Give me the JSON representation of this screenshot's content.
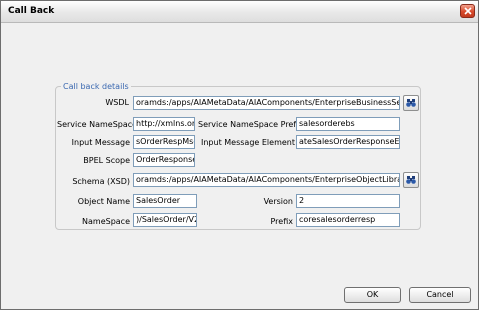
{
  "window": {
    "title": "Call Back"
  },
  "group": {
    "legend": "Call back details"
  },
  "fields": {
    "wsdl": {
      "label": "WSDL",
      "value": "oramds:/apps/AIAMetaData/AIAComponents/EnterpriseBusinessServiceLi"
    },
    "service_namespace": {
      "label": "Service NameSpace",
      "value": "http://xmlns.orac"
    },
    "service_namespace_prefix": {
      "label": "Service NameSpace Prefix",
      "value": "salesorderebs"
    },
    "input_message": {
      "label": "Input Message",
      "value": "sOrderRespMsg"
    },
    "input_message_element": {
      "label": "Input Message Element",
      "value": "ateSalesOrderResponseEBM"
    },
    "bpel_scope": {
      "label": "BPEL Scope",
      "value": "OrderResponse"
    },
    "schema": {
      "label": "Schema (XSD)",
      "value": "oramds:/apps/AIAMetaData/AIAComponents/EnterpriseObjectLibrary/Cor"
    },
    "object_name": {
      "label": "Object Name",
      "value": "SalesOrder"
    },
    "version": {
      "label": "Version",
      "value": "2"
    },
    "namespace": {
      "label": "NameSpace",
      "value": ")/SalesOrder/V2"
    },
    "prefix": {
      "label": "Prefix",
      "value": "coresalesorderresp"
    }
  },
  "buttons": {
    "ok": "OK",
    "cancel": "Cancel"
  },
  "icons": {
    "close": "close-icon",
    "browse": "binoculars-icon"
  },
  "colors": {
    "legend": "#3a68b0",
    "close_button": "#d84a2b"
  }
}
